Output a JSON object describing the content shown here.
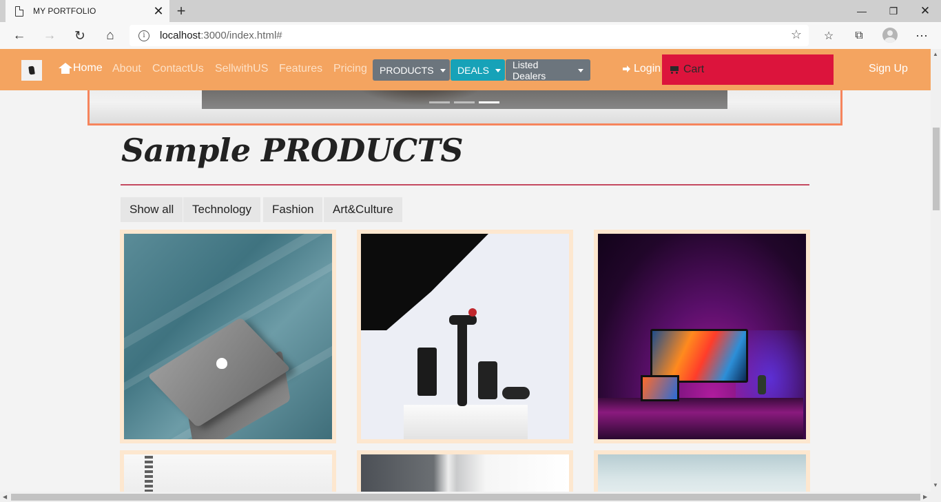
{
  "browser": {
    "tab_title": "MY PORTFOLIO",
    "url_host": "localhost",
    "url_rest": ":3000/index.html#"
  },
  "navbar": {
    "home": "Home",
    "links": [
      "About",
      "ContactUs",
      "SellwithUS",
      "Features",
      "Pricing"
    ],
    "dropdowns": [
      {
        "label": "PRODUCTS",
        "color": "#6c757d"
      },
      {
        "label": "DEALS",
        "color": "#17a2b8"
      },
      {
        "label": "Listed Dealers",
        "color": "#6c757d"
      }
    ],
    "login": "Login",
    "cart": "Cart",
    "signup": "Sign Up",
    "colors": {
      "bar": "#f4a460",
      "cart": "#dc143c"
    }
  },
  "carousel": {
    "indicator_count": 3,
    "active_index": 2
  },
  "products": {
    "heading": "Sample PRODUCTS",
    "filters": [
      "Show all",
      "Technology",
      "Fashion",
      "Art&Culture"
    ],
    "items": [
      "laptop-photo",
      "camera-gear-photo",
      "monitor-setup-photo",
      "tree-photo",
      "steel-pole-photo",
      "sky-photo"
    ]
  }
}
